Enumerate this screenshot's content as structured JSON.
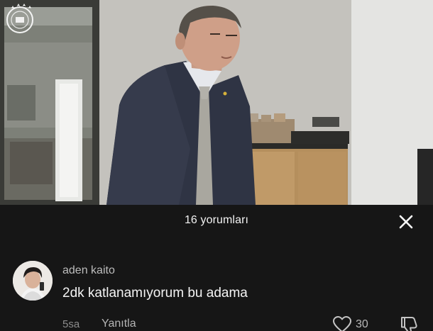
{
  "comments_panel": {
    "title": "16 yorumları",
    "close_icon": "close-icon"
  },
  "comments": [
    {
      "username": "aden kaito",
      "text": "2dk katlanamıyorum bu adama",
      "time": "5sa",
      "reply_label": "Yanıtla",
      "like_count": "30",
      "like_icon": "heart-outline-icon",
      "dislike_icon": "thumbs-down-outline-icon"
    }
  ],
  "colors": {
    "sheet_background": "#161616",
    "primary_text": "#f4f4f4",
    "secondary_text": "#8d8d8d"
  }
}
